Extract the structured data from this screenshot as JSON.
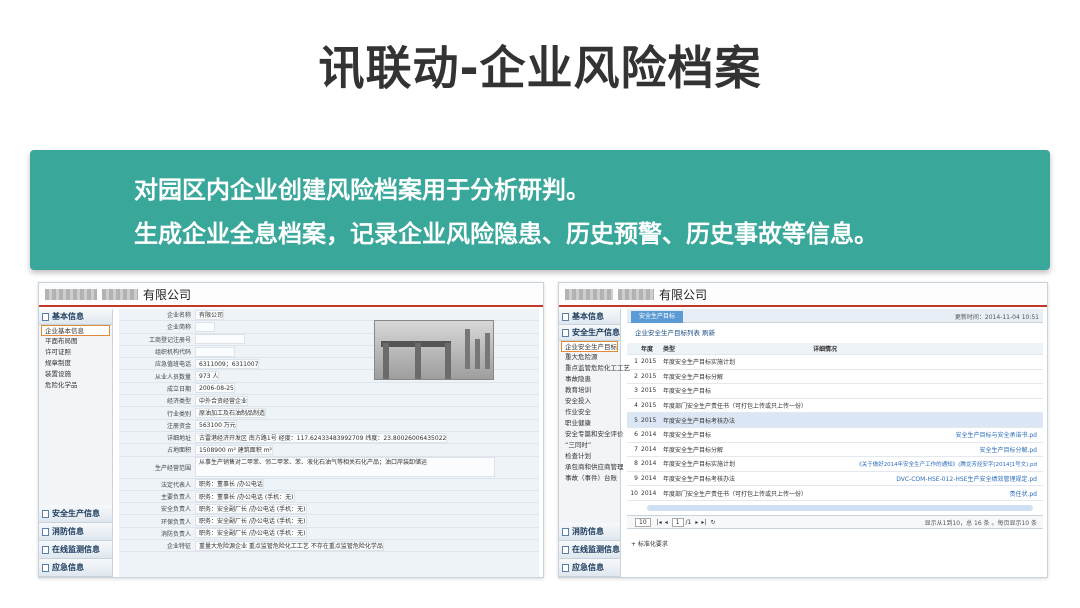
{
  "slide": {
    "title": "讯联动-企业风险档案",
    "banner_line1": "对园区内企业创建风险档案用于分析研判。",
    "banner_line2": "生成企业全息档案，记录企业风险隐患、历史预警、历史事故等信息。"
  },
  "left_screen": {
    "company_suffix": "有限公司",
    "sidebar_title": "基本信息",
    "sidebar_items": [
      "企业基本信息",
      "平面布局图",
      "许可证照",
      "规章制度",
      "装置设施",
      "危险化学品"
    ],
    "sidebar_bottom": [
      "安全生产信息",
      "消防信息",
      "在线监测信息",
      "应急信息"
    ],
    "form": [
      {
        "label": "企业名称",
        "value": "有限公司"
      },
      {
        "label": "企业简称",
        "value": ""
      },
      {
        "label": "工商登记注册号",
        "value": ""
      },
      {
        "label": "组织机构代码",
        "value": ""
      },
      {
        "label": "应急值班电话",
        "value": "6311009；6311007"
      },
      {
        "label": "从业人员数量",
        "value": "973  人"
      },
      {
        "label": "成立日期",
        "value": "2006-08-25"
      },
      {
        "label": "经济类型",
        "value": "中外合资经营企业"
      },
      {
        "label": "行业类别",
        "value": "原油加工及石油制品制造"
      },
      {
        "label": "注册资金",
        "value": "563100  万元"
      },
      {
        "label": "详细地址",
        "value": "古雷港经济开发区 南方路1号 经度：117.62433483992709  纬度：23.80026006435022"
      },
      {
        "label": "占地面积",
        "value": "1508900  m²     建筑面积  m²"
      },
      {
        "label": "生产经营范围",
        "value": "从事生产销售对二甲苯、邻二甲苯、苯、液化石油气等相关石化产品；油口岸装卸储运"
      },
      {
        "label": "法定代表人",
        "value": "职务：董事长 /办公电话"
      },
      {
        "label": "主要负责人",
        "value": "职务：董事长 /办公电话          (手机：无)"
      },
      {
        "label": "安全负责人",
        "value": "职务：安全副厂长 /办公电话          (手机：无)"
      },
      {
        "label": "环保负责人",
        "value": "职务：安全副厂长 /办公电话          (手机：无)"
      },
      {
        "label": "消防负责人",
        "value": "职务：安全副厂长 /办公电话          (手机：无)"
      },
      {
        "label": "企业特征",
        "value": "重量大危险源企业  重点监管危险化工工艺  不存在重点监管危险化学品"
      }
    ]
  },
  "right_screen": {
    "company_suffix": "有限公司",
    "sidebar_title": "基本信息",
    "sidebar_title2": "安全生产信息",
    "sidebar_items": [
      "企业安全生产目标",
      "重大危险源",
      "重点监管危险化工工艺",
      "事故隐患",
      "教育培训",
      "安全投入",
      "作业安全",
      "职业健康",
      "安全专篇和安全评价",
      "“三同时”",
      "检查计划",
      "承包商和供应商管理",
      "事故（事件）台账"
    ],
    "sidebar_bottom": [
      "消防信息",
      "在线监测信息",
      "应急信息"
    ],
    "tab_label": "安全生产目标",
    "update_time": "更新时间：2014-11-04 10:51",
    "toolbar": "企业安全生产目标列表     刷新",
    "table_header": {
      "no": "",
      "year": "年度",
      "type": "类型",
      "detail": "详细情况"
    },
    "rows": [
      {
        "no": "1",
        "year": "2015",
        "type": "年度安全生产目标实施计划",
        "detail": ""
      },
      {
        "no": "2",
        "year": "2015",
        "type": "年度安全生产目标分解",
        "detail": ""
      },
      {
        "no": "3",
        "year": "2015",
        "type": "年度安全生产目标",
        "detail": ""
      },
      {
        "no": "4",
        "year": "2015",
        "type": "年度部门安全生产责任书（可打包上传或只上传一份）",
        "detail": ""
      },
      {
        "no": "5",
        "year": "2015",
        "type": "年度安全生产目标考核办法",
        "detail": ""
      },
      {
        "no": "6",
        "year": "2014",
        "type": "年度安全生产目标",
        "detail": "安全生产目标与安全承诺书.pd"
      },
      {
        "no": "7",
        "year": "2014",
        "type": "年度安全生产目标分解",
        "detail": "安全生产目标分解.pd"
      },
      {
        "no": "8",
        "year": "2014",
        "type": "年度安全生产目标实施计划",
        "detail": "《关于做好2014年安全生产工作的通知》(腾龙芳烃安字[2014]1号文).pd"
      },
      {
        "no": "9",
        "year": "2014",
        "type": "年度安全生产目标考核办法",
        "detail": "DVC-COM-HSE-012-HSE生产安全绩效管理规定.pd"
      },
      {
        "no": "10",
        "year": "2014",
        "type": "年度部门安全生产责任书（可打包上传或只上传一份）",
        "detail": "责任状.pd"
      }
    ],
    "pager_size": "10",
    "pager_page": "1",
    "pager_total_pages": "/1",
    "pager_info": "显示从1到10，总 16 条 。每页显示10 条",
    "extra_label": "+ 标准化要求"
  }
}
